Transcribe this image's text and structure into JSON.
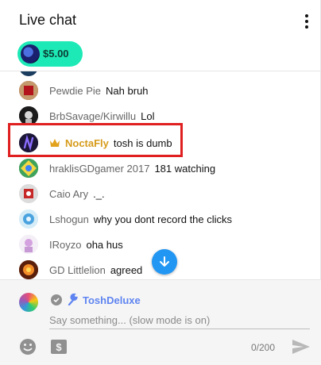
{
  "header": {
    "title": "Live chat",
    "menu_icon": "more-vert-icon"
  },
  "ticker": {
    "amount": "$5.00",
    "color": "#1de9b6"
  },
  "messages": [
    {
      "author": "Pewdie Pie",
      "text": "Nah bruh"
    },
    {
      "author": "BrbSavage/Kirwillu",
      "text": "Lol"
    },
    {
      "author": "NoctaFly",
      "text": "tosh is dumb",
      "badge": "crown-icon",
      "author_color": "#d69b1a",
      "highlighted": true
    },
    {
      "author": "hraklisGDgamer 2017",
      "text": "181 watching"
    },
    {
      "author": "Caio Ary",
      "text": "._."
    },
    {
      "author": "Lshogun",
      "text": "why you dont record the clicks"
    },
    {
      "author": "IRoyzo",
      "text": "oha hus"
    },
    {
      "author": "GD Littlelion",
      "text": "agreed"
    }
  ],
  "input": {
    "username": "ToshDeluxe",
    "placeholder": "Say something... (slow mode is on)",
    "value": "",
    "counter": "0/200",
    "icons": [
      "verified-icon",
      "wrench-icon",
      "emoji-icon",
      "super-chat-icon",
      "send-icon"
    ]
  },
  "colors": {
    "highlight": "#e02020",
    "accent": "#2196f3",
    "name_link": "#5e84f1"
  }
}
